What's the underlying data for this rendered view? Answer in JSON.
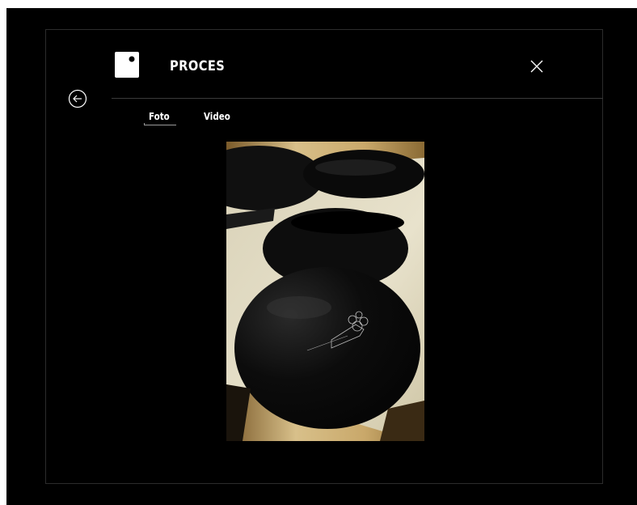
{
  "modal": {
    "title": "PROCES",
    "close_icon": "close-icon",
    "back_icon": "arrow-left-circle-icon",
    "logo_icon": "square-dot-logo"
  },
  "tabs": [
    {
      "label": "Foto",
      "active": true
    },
    {
      "label": "Video",
      "active": false
    }
  ],
  "colors": {
    "background": "#000000",
    "text": "#ffffff",
    "divider": "#3a3a3a"
  }
}
